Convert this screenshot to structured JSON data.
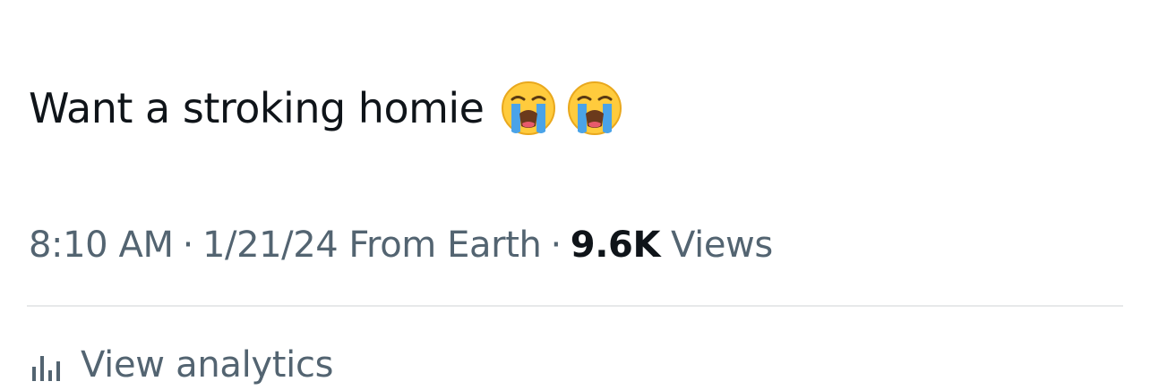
{
  "tweet": {
    "text": "Want a stroking homie",
    "emojis": [
      "loudly-crying-face-icon",
      "loudly-crying-face-icon"
    ]
  },
  "meta": {
    "time": "8:10 AM",
    "separator": "·",
    "date": "1/21/24",
    "source": "From Earth",
    "views_count": "9.6K",
    "views_label": "Views"
  },
  "analytics": {
    "icon": "bar-chart-icon",
    "label": "View analytics"
  },
  "colors": {
    "primary_text": "#0f1419",
    "secondary_text": "#536471",
    "divider": "#e7e9ea",
    "emoji_face": "#ffcb3d",
    "emoji_tears": "#4aa3e8"
  }
}
